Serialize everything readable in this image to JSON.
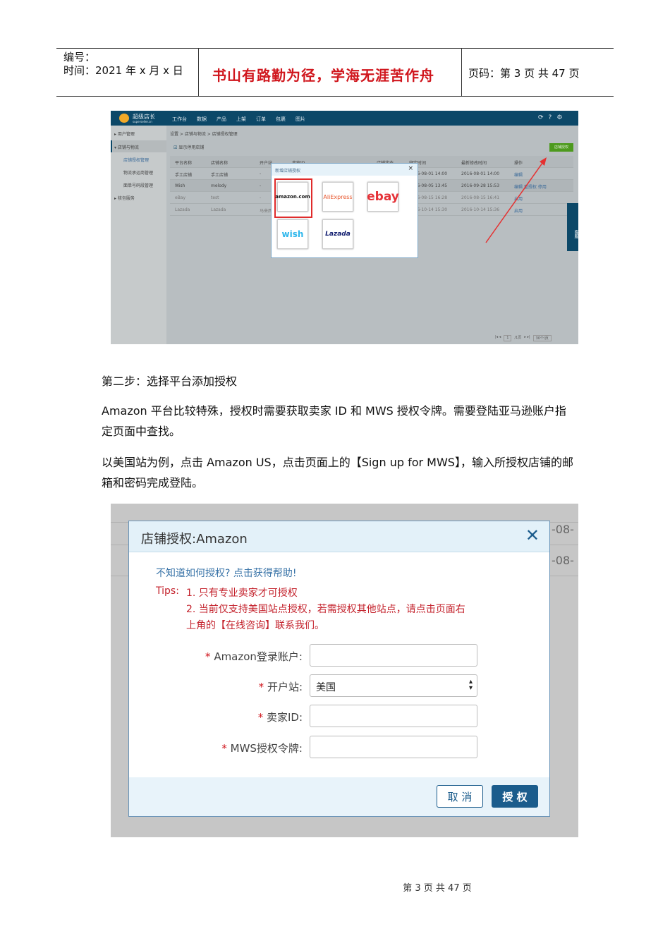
{
  "header": {
    "number_label": "编号：",
    "time_label": "时间：2021 年 x 月 x 日",
    "motto": "书山有路勤为径，学海无涯苦作舟",
    "page_label": "页码：第 3 页  共 47 页"
  },
  "shot1": {
    "logo": "超级店长",
    "logo_sub": "superseller.cn",
    "nav": [
      "工作台",
      "数据",
      "产品",
      "上架",
      "订单",
      "包裹",
      "图片"
    ],
    "sidebar": [
      "用户管理",
      "店铺与物流",
      "店铺授权管理",
      "物流承运商管理",
      "面单号码段管理",
      "核包服务"
    ],
    "breadcrumb": "设置 > 店铺与物流 > 店铺授权管理",
    "show_disabled": "显示停用店铺",
    "auth_button": "店铺授权",
    "columns": [
      "平台名称",
      "店铺名称",
      "开户站",
      "卖家ID",
      "店铺状态",
      "绑定时间",
      "最新修改时间",
      "操作"
    ],
    "rows": [
      {
        "platform": "手工店铺",
        "shop": "手工店铺",
        "site": "-",
        "bind": "2016-08-01 14:00",
        "modified": "2016-08-01 14:00",
        "actions": "编辑"
      },
      {
        "platform": "Wish",
        "shop": "melody",
        "site": "-",
        "bind": "2016-08-05 13:45",
        "modified": "2016-09-28 15:53",
        "actions": "编辑  重授权  停用"
      },
      {
        "platform": "eBay",
        "shop": "test",
        "site": "-",
        "bind": "2016-08-15 16:28",
        "modified": "2016-08-15 16:41",
        "actions": "启用"
      },
      {
        "platform": "Lazada",
        "shop": "Lazada",
        "site": "马来西亚",
        "bind": "2016-10-14 15:30",
        "modified": "2016-10-14 15:36",
        "actions": "启用"
      }
    ],
    "modal_title": "新增店铺授权",
    "platforms": [
      "amazon.com",
      "AliExpress",
      "ebay",
      "wish",
      "Lazada"
    ],
    "service": "客服",
    "pager": {
      "page": "1",
      "total": "/1页",
      "per_page": "30个/页"
    }
  },
  "step_title": "第二步：选择平台添加授权",
  "para1": "Amazon 平台比较特殊，授权时需要获取卖家 ID 和 MWS 授权令牌。需要登陆亚马逊账户指定页面中查找。",
  "para2": "以美国站为例，点击 Amazon US，点击页面上的【Sign up for MWS】，输入所授权店铺的邮箱和密码完成登陆。",
  "shot2": {
    "title": "店铺授权:Amazon",
    "help": "不知道如何授权? 点击获得帮助!",
    "tips_label": "Tips:",
    "tip1": "1. 只有专业卖家才可授权",
    "tip2": "2. 当前仅支持美国站点授权，若需授权其他站点，请点击页面右",
    "tip2b": "上角的【在线咨询】联系我们。",
    "fields": [
      {
        "label": "Amazon登录账户:",
        "value": ""
      },
      {
        "label": "开户站:",
        "value": "美国"
      },
      {
        "label": "卖家ID:",
        "value": ""
      },
      {
        "label": "MWS授权令牌:",
        "value": ""
      }
    ],
    "bg_fragment": "-08-",
    "cancel": "取 消",
    "submit": "授 权"
  },
  "footer": "第  3  页  共  47  页"
}
